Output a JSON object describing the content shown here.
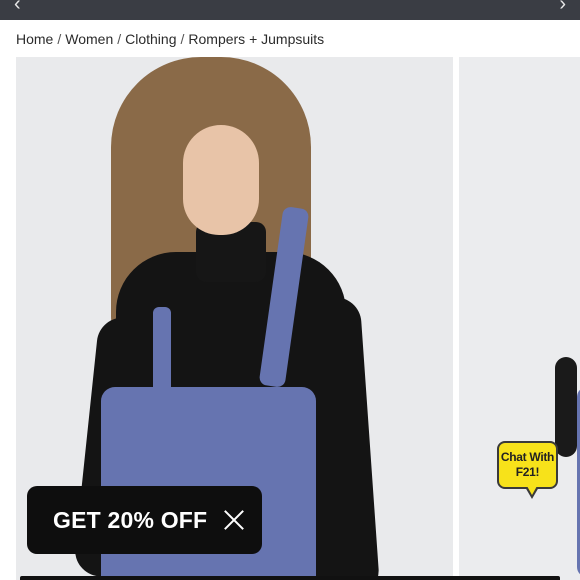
{
  "top_banner": {
    "text": "— , — —, — —"
  },
  "breadcrumb": {
    "items": [
      "Home",
      "Women",
      "Clothing",
      "Rompers + Jumpsuits"
    ],
    "separator": "/"
  },
  "gallery": {
    "images": [
      {
        "alt": "product-photo-front"
      },
      {
        "alt": "product-photo-next"
      }
    ]
  },
  "chat_widget": {
    "line1": "Chat With",
    "line2": "F21!"
  },
  "promo_popup": {
    "label": "GET 20% OFF"
  },
  "icons": {
    "prev": "chevron-left-icon",
    "next": "chevron-right-icon",
    "close": "close-icon"
  },
  "colors": {
    "topbar": "#3a3d44",
    "chat_badge": "#f7e21a",
    "promo_bg": "#0e0e0e",
    "denim": "#6674b0"
  }
}
